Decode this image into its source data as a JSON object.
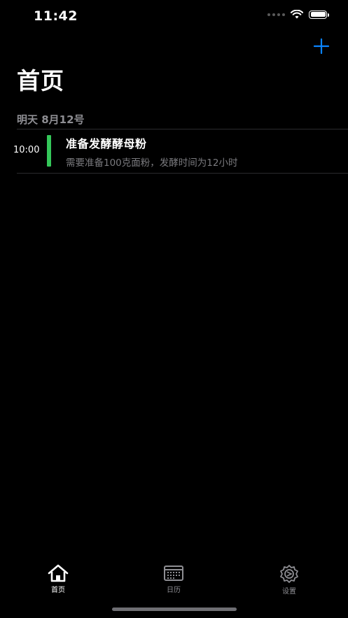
{
  "status_bar": {
    "time": "11:42"
  },
  "header": {
    "title": "首页"
  },
  "schedule": {
    "section_label": "明天 8月12号",
    "events": [
      {
        "time": "10:00",
        "title": "准备发酵酵母粉",
        "subtitle": "需要准备100克面粉，发酵时间为12小时",
        "color": "#34c759"
      }
    ]
  },
  "tab_bar": {
    "tabs": [
      {
        "label": "首页",
        "icon": "home-icon",
        "active": true
      },
      {
        "label": "日历",
        "icon": "calendar-icon",
        "active": false
      },
      {
        "label": "设置",
        "icon": "gear-icon",
        "active": false
      }
    ]
  },
  "colors": {
    "accent": "#0a84ff",
    "background": "#000000",
    "event_bar": "#34c759",
    "secondary_text": "#8e8e93",
    "inactive_tab": "#8e8e93"
  }
}
